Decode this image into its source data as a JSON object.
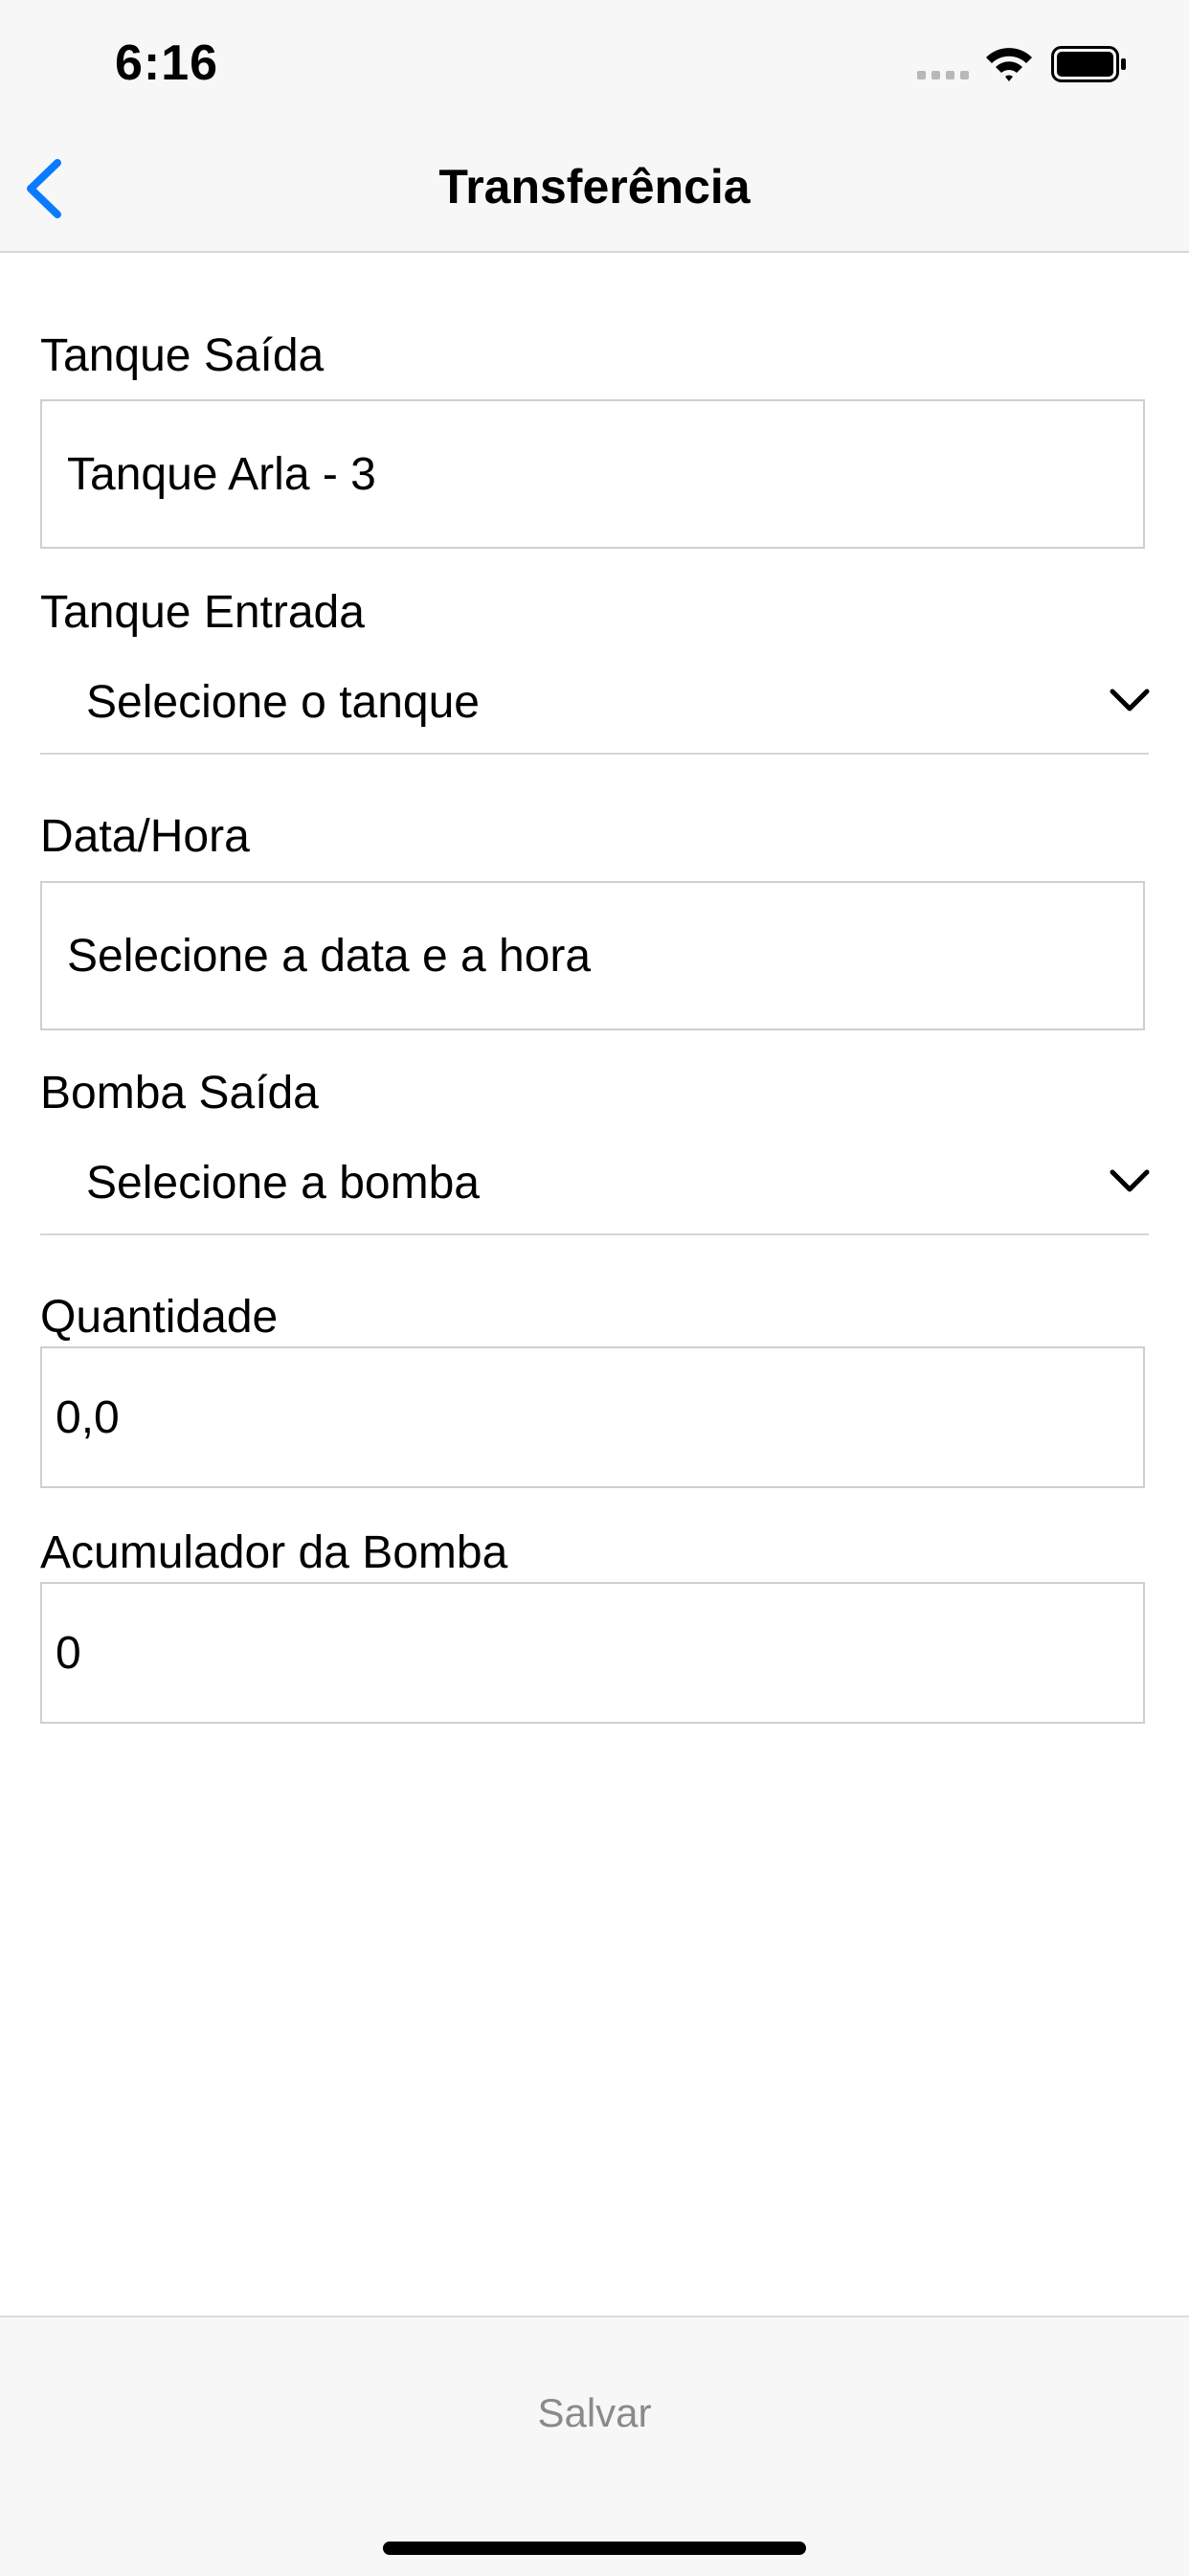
{
  "status_bar": {
    "time": "6:16"
  },
  "nav": {
    "title": "Transferência",
    "back_icon": "chevron-left-icon"
  },
  "form": {
    "tanque_saida": {
      "label": "Tanque Saída",
      "value": "Tanque Arla - 3"
    },
    "tanque_entrada": {
      "label": "Tanque Entrada",
      "value": "Selecione o tanque"
    },
    "data_hora": {
      "label": "Data/Hora",
      "value": "Selecione a data e a hora"
    },
    "bomba_saida": {
      "label": "Bomba Saída",
      "value": "Selecione a bomba"
    },
    "quantidade": {
      "label": "Quantidade",
      "value": "0,0"
    },
    "acumulador": {
      "label": "Acumulador da Bomba",
      "value": "0"
    }
  },
  "footer": {
    "save_label": "Salvar"
  },
  "colors": {
    "accent": "#0a7aff",
    "bar_background": "#f7f7f7",
    "disabled_text": "#8a8a8a"
  }
}
